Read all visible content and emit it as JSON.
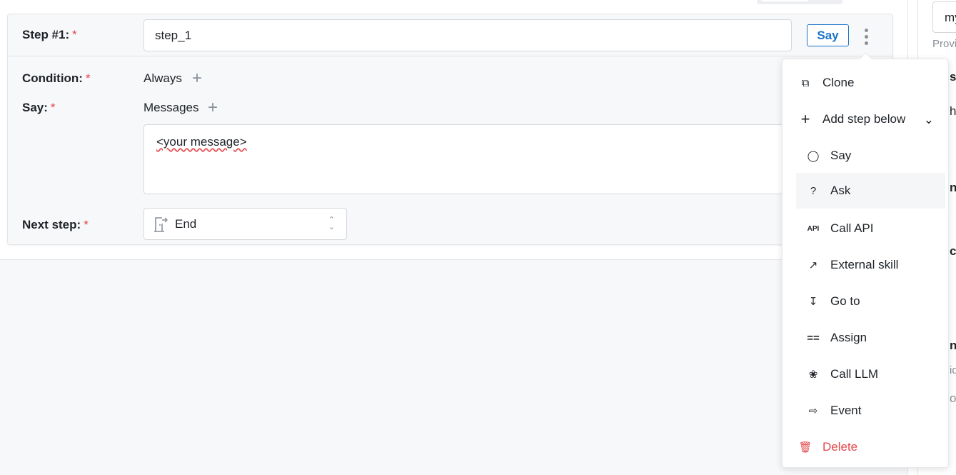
{
  "step": {
    "label": "Step #1:",
    "required_mark": "*",
    "name_value": "step_1",
    "type_button": "Say",
    "condition_label": "Condition:",
    "condition_value": "Always",
    "say_label": "Say:",
    "say_value": "Messages",
    "message_text": "<your message>",
    "next_step_label": "Next step:",
    "next_step_value": "End"
  },
  "menu": {
    "clone": "Clone",
    "add_step_below": "Add step below",
    "items": [
      {
        "label": "Say",
        "icon": "speech-bubble-icon"
      },
      {
        "label": "Ask",
        "icon": "question-icon"
      },
      {
        "label": "Call API",
        "icon": "api-icon"
      },
      {
        "label": "External skill",
        "icon": "external-link-icon"
      },
      {
        "label": "Go to",
        "icon": "arrow-down-icon"
      },
      {
        "label": "Assign",
        "icon": "equals-icon"
      },
      {
        "label": "Call LLM",
        "icon": "brain-icon"
      },
      {
        "label": "Event",
        "icon": "event-icon"
      }
    ],
    "delete": "Delete",
    "highlighted": "Ask"
  },
  "right_panel": {
    "input_value": "my",
    "hint": "Provi",
    "fragments": [
      "so",
      "h",
      "ng",
      "ce",
      "n",
      "id",
      "o"
    ]
  },
  "colors": {
    "accent": "#1a73c8",
    "danger": "#e5484d"
  }
}
